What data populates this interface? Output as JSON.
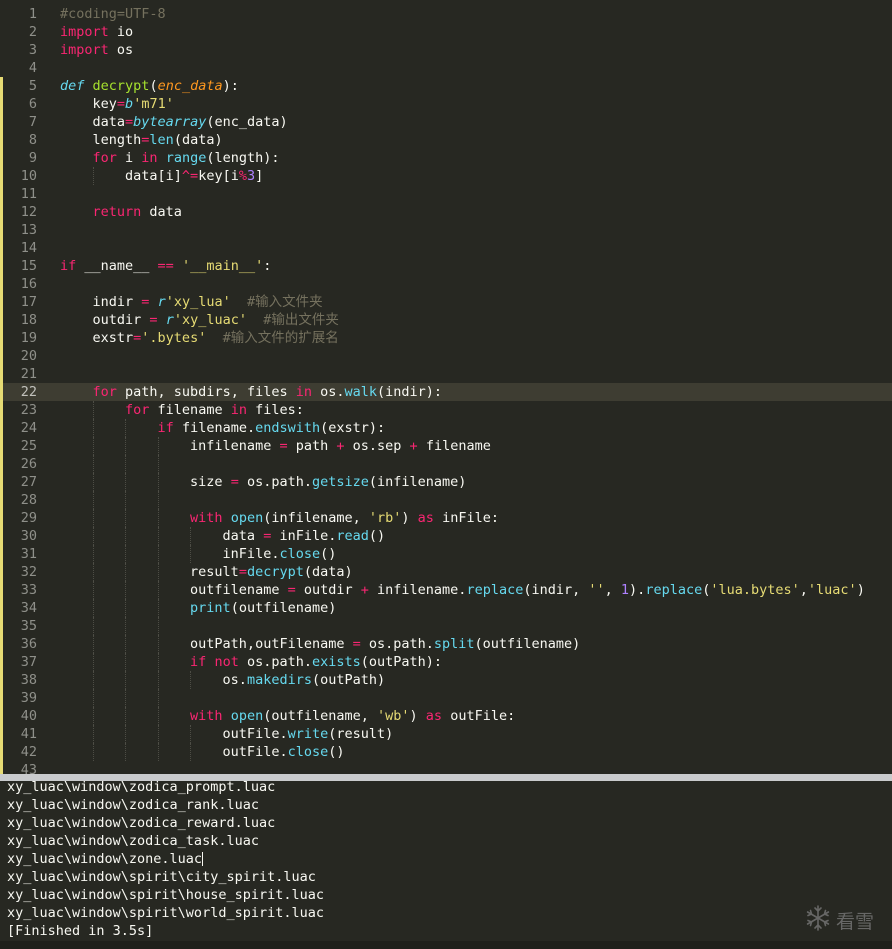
{
  "editor": {
    "active_line": 22,
    "modified_lines": [
      5,
      6,
      7,
      8,
      9,
      10,
      11,
      12,
      13,
      14,
      15,
      16,
      17,
      18,
      19,
      20,
      21,
      22,
      23,
      24,
      25,
      26,
      27,
      28,
      29,
      30,
      31,
      32,
      33,
      34,
      35,
      36,
      37,
      38,
      39,
      40,
      41,
      42,
      43
    ],
    "lines": [
      {
        "n": "1",
        "g": [],
        "t": [
          [
            "c",
            "#coding=UTF-8"
          ]
        ]
      },
      {
        "n": "2",
        "g": [],
        "t": [
          [
            "k",
            "import"
          ],
          [
            "p",
            " io"
          ]
        ]
      },
      {
        "n": "3",
        "g": [],
        "t": [
          [
            "k",
            "import"
          ],
          [
            "p",
            " os"
          ]
        ]
      },
      {
        "n": "4",
        "g": [],
        "t": []
      },
      {
        "n": "5",
        "g": [],
        "t": [
          [
            "d",
            "def"
          ],
          [
            "p",
            " "
          ],
          [
            "f",
            "decrypt"
          ],
          [
            "p",
            "("
          ],
          [
            "a",
            "enc_data"
          ],
          [
            "p",
            "):"
          ]
        ]
      },
      {
        "n": "6",
        "g": [],
        "t": [
          [
            "p",
            "    key"
          ],
          [
            "o",
            "="
          ],
          [
            "d",
            "b"
          ],
          [
            "s",
            "'m71'"
          ]
        ]
      },
      {
        "n": "7",
        "g": [],
        "t": [
          [
            "p",
            "    data"
          ],
          [
            "o",
            "="
          ],
          [
            "d",
            "bytearray"
          ],
          [
            "p",
            "(enc_data)"
          ]
        ]
      },
      {
        "n": "8",
        "g": [],
        "t": [
          [
            "p",
            "    length"
          ],
          [
            "o",
            "="
          ],
          [
            "b",
            "len"
          ],
          [
            "p",
            "(data)"
          ]
        ]
      },
      {
        "n": "9",
        "g": [],
        "t": [
          [
            "p",
            "    "
          ],
          [
            "k",
            "for"
          ],
          [
            "p",
            " i "
          ],
          [
            "k",
            "in"
          ],
          [
            "p",
            " "
          ],
          [
            "b",
            "range"
          ],
          [
            "p",
            "(length):"
          ]
        ]
      },
      {
        "n": "10",
        "g": [
          4
        ],
        "t": [
          [
            "p",
            "        data[i]"
          ],
          [
            "o",
            "^="
          ],
          [
            "p",
            "key[i"
          ],
          [
            "o",
            "%"
          ],
          [
            "n",
            "3"
          ],
          [
            "p",
            "]"
          ]
        ]
      },
      {
        "n": "11",
        "g": [],
        "t": []
      },
      {
        "n": "12",
        "g": [],
        "t": [
          [
            "p",
            "    "
          ],
          [
            "k",
            "return"
          ],
          [
            "p",
            " data"
          ]
        ]
      },
      {
        "n": "13",
        "g": [],
        "t": []
      },
      {
        "n": "14",
        "g": [],
        "t": []
      },
      {
        "n": "15",
        "g": [],
        "t": [
          [
            "k",
            "if"
          ],
          [
            "p",
            " __name__ "
          ],
          [
            "o",
            "=="
          ],
          [
            "p",
            " "
          ],
          [
            "s",
            "'__main__'"
          ],
          [
            "p",
            ":"
          ]
        ]
      },
      {
        "n": "16",
        "g": [],
        "t": []
      },
      {
        "n": "17",
        "g": [],
        "t": [
          [
            "p",
            "    indir "
          ],
          [
            "o",
            "="
          ],
          [
            "p",
            " "
          ],
          [
            "d",
            "r"
          ],
          [
            "s",
            "'xy_lua'"
          ],
          [
            "p",
            "  "
          ],
          [
            "c",
            "#输入文件夹"
          ]
        ]
      },
      {
        "n": "18",
        "g": [],
        "t": [
          [
            "p",
            "    outdir "
          ],
          [
            "o",
            "="
          ],
          [
            "p",
            " "
          ],
          [
            "d",
            "r"
          ],
          [
            "s",
            "'xy_luac'"
          ],
          [
            "p",
            "  "
          ],
          [
            "c",
            "#输出文件夹"
          ]
        ]
      },
      {
        "n": "19",
        "g": [],
        "t": [
          [
            "p",
            "    exstr"
          ],
          [
            "o",
            "="
          ],
          [
            "s",
            "'.bytes'"
          ],
          [
            "p",
            "  "
          ],
          [
            "c",
            "#输入文件的扩展名"
          ]
        ]
      },
      {
        "n": "20",
        "g": [],
        "t": []
      },
      {
        "n": "21",
        "g": [],
        "t": []
      },
      {
        "n": "22",
        "g": [],
        "t": [
          [
            "p",
            "    "
          ],
          [
            "k",
            "for"
          ],
          [
            "p",
            " path, subdirs, files "
          ],
          [
            "k",
            "in"
          ],
          [
            "p",
            " os."
          ],
          [
            "b",
            "walk"
          ],
          [
            "p",
            "(indir):"
          ]
        ]
      },
      {
        "n": "23",
        "g": [
          4
        ],
        "t": [
          [
            "p",
            "        "
          ],
          [
            "k",
            "for"
          ],
          [
            "p",
            " filename "
          ],
          [
            "k",
            "in"
          ],
          [
            "p",
            " files:"
          ]
        ]
      },
      {
        "n": "24",
        "g": [
          4,
          8
        ],
        "t": [
          [
            "p",
            "            "
          ],
          [
            "k",
            "if"
          ],
          [
            "p",
            " filename."
          ],
          [
            "b",
            "endswith"
          ],
          [
            "p",
            "(exstr):"
          ]
        ]
      },
      {
        "n": "25",
        "g": [
          4,
          8,
          12
        ],
        "t": [
          [
            "p",
            "                infilename "
          ],
          [
            "o",
            "="
          ],
          [
            "p",
            " path "
          ],
          [
            "o",
            "+"
          ],
          [
            "p",
            " os.sep "
          ],
          [
            "o",
            "+"
          ],
          [
            "p",
            " filename"
          ]
        ]
      },
      {
        "n": "26",
        "g": [
          4,
          8,
          12
        ],
        "t": []
      },
      {
        "n": "27",
        "g": [
          4,
          8,
          12
        ],
        "t": [
          [
            "p",
            "                size "
          ],
          [
            "o",
            "="
          ],
          [
            "p",
            " os.path."
          ],
          [
            "b",
            "getsize"
          ],
          [
            "p",
            "(infilename)"
          ]
        ]
      },
      {
        "n": "28",
        "g": [
          4,
          8,
          12
        ],
        "t": []
      },
      {
        "n": "29",
        "g": [
          4,
          8,
          12
        ],
        "t": [
          [
            "p",
            "                "
          ],
          [
            "k",
            "with"
          ],
          [
            "p",
            " "
          ],
          [
            "b",
            "open"
          ],
          [
            "p",
            "(infilename, "
          ],
          [
            "s",
            "'rb'"
          ],
          [
            "p",
            ") "
          ],
          [
            "k",
            "as"
          ],
          [
            "p",
            " inFile:"
          ]
        ]
      },
      {
        "n": "30",
        "g": [
          4,
          8,
          12,
          16
        ],
        "t": [
          [
            "p",
            "                    data "
          ],
          [
            "o",
            "="
          ],
          [
            "p",
            " inFile."
          ],
          [
            "b",
            "read"
          ],
          [
            "p",
            "()"
          ]
        ]
      },
      {
        "n": "31",
        "g": [
          4,
          8,
          12,
          16
        ],
        "t": [
          [
            "p",
            "                    inFile."
          ],
          [
            "b",
            "close"
          ],
          [
            "p",
            "()"
          ]
        ]
      },
      {
        "n": "32",
        "g": [
          4,
          8,
          12
        ],
        "t": [
          [
            "p",
            "                result"
          ],
          [
            "o",
            "="
          ],
          [
            "b",
            "decrypt"
          ],
          [
            "p",
            "(data)"
          ]
        ]
      },
      {
        "n": "33",
        "g": [
          4,
          8,
          12
        ],
        "t": [
          [
            "p",
            "                outfilename "
          ],
          [
            "o",
            "="
          ],
          [
            "p",
            " outdir "
          ],
          [
            "o",
            "+"
          ],
          [
            "p",
            " infilename."
          ],
          [
            "b",
            "replace"
          ],
          [
            "p",
            "(indir, "
          ],
          [
            "s",
            "''"
          ],
          [
            "p",
            ", "
          ],
          [
            "n",
            "1"
          ],
          [
            "p",
            ")."
          ],
          [
            "b",
            "replace"
          ],
          [
            "p",
            "("
          ],
          [
            "s",
            "'lua.bytes'"
          ],
          [
            "p",
            ","
          ],
          [
            "s",
            "'luac'"
          ],
          [
            "p",
            ")"
          ]
        ]
      },
      {
        "n": "34",
        "g": [
          4,
          8,
          12
        ],
        "t": [
          [
            "p",
            "                "
          ],
          [
            "b",
            "print"
          ],
          [
            "p",
            "(outfilename)"
          ]
        ]
      },
      {
        "n": "35",
        "g": [
          4,
          8,
          12
        ],
        "t": []
      },
      {
        "n": "36",
        "g": [
          4,
          8,
          12
        ],
        "t": [
          [
            "p",
            "                outPath,outFilename "
          ],
          [
            "o",
            "="
          ],
          [
            "p",
            " os.path."
          ],
          [
            "b",
            "split"
          ],
          [
            "p",
            "(outfilename)"
          ]
        ]
      },
      {
        "n": "37",
        "g": [
          4,
          8,
          12
        ],
        "t": [
          [
            "p",
            "                "
          ],
          [
            "k",
            "if"
          ],
          [
            "p",
            " "
          ],
          [
            "k",
            "not"
          ],
          [
            "p",
            " os.path."
          ],
          [
            "b",
            "exists"
          ],
          [
            "p",
            "(outPath):"
          ]
        ]
      },
      {
        "n": "38",
        "g": [
          4,
          8,
          12,
          16
        ],
        "t": [
          [
            "p",
            "                    os."
          ],
          [
            "b",
            "makedirs"
          ],
          [
            "p",
            "(outPath)"
          ]
        ]
      },
      {
        "n": "39",
        "g": [
          4,
          8,
          12
        ],
        "t": []
      },
      {
        "n": "40",
        "g": [
          4,
          8,
          12
        ],
        "t": [
          [
            "p",
            "                "
          ],
          [
            "k",
            "with"
          ],
          [
            "p",
            " "
          ],
          [
            "b",
            "open"
          ],
          [
            "p",
            "(outfilename, "
          ],
          [
            "s",
            "'wb'"
          ],
          [
            "p",
            ") "
          ],
          [
            "k",
            "as"
          ],
          [
            "p",
            " outFile:"
          ]
        ]
      },
      {
        "n": "41",
        "g": [
          4,
          8,
          12,
          16
        ],
        "t": [
          [
            "p",
            "                    outFile."
          ],
          [
            "b",
            "write"
          ],
          [
            "p",
            "(result)"
          ]
        ]
      },
      {
        "n": "42",
        "g": [
          4,
          8,
          12,
          16
        ],
        "t": [
          [
            "p",
            "                    outFile."
          ],
          [
            "b",
            "close"
          ],
          [
            "p",
            "()"
          ]
        ]
      },
      {
        "n": "43",
        "g": [],
        "t": []
      }
    ]
  },
  "output": {
    "lines": [
      "xy_luac\\window\\zodica_prompt.luac",
      "xy_luac\\window\\zodica_rank.luac",
      "xy_luac\\window\\zodica_reward.luac",
      "xy_luac\\window\\zodica_task.luac",
      "xy_luac\\window\\zone.luac",
      "xy_luac\\window\\spirit\\city_spirit.luac",
      "xy_luac\\window\\spirit\\house_spirit.luac",
      "xy_luac\\window\\spirit\\world_spirit.luac",
      "[Finished in 3.5s]"
    ],
    "caret_line": 4
  },
  "watermark": {
    "text": "看雪",
    "icon": "snowflake-icon"
  },
  "colors": {
    "background": "#272822",
    "modified_marker": "#e6db74",
    "active_line": "#3e3d32",
    "divider": "#c9cbcd"
  }
}
